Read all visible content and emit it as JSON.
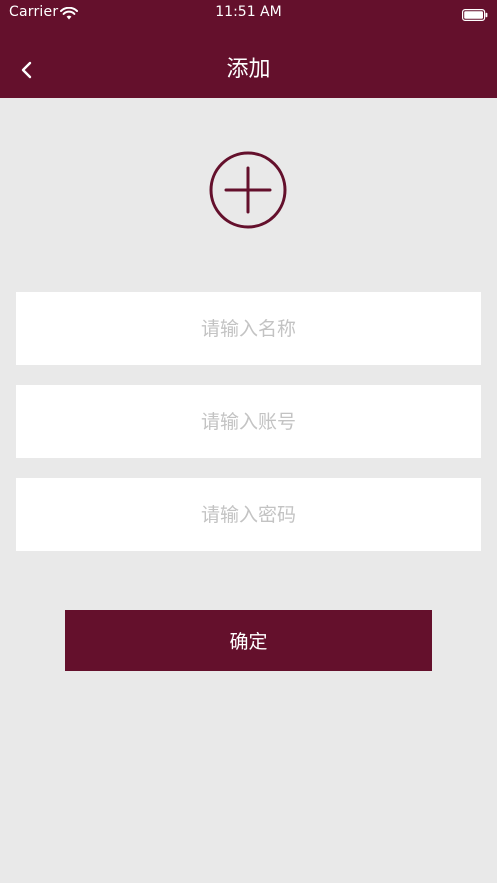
{
  "status_bar": {
    "carrier": "Carrier",
    "time": "11:51 AM"
  },
  "nav": {
    "title": "添加",
    "back_icon": "chevron-left-icon"
  },
  "avatar": {
    "icon": "plus-circle-icon"
  },
  "form": {
    "name_placeholder": "请输入名称",
    "account_placeholder": "请输入账号",
    "password_placeholder": "请输入密码",
    "name_value": "",
    "account_value": "",
    "password_value": ""
  },
  "actions": {
    "confirm_label": "确定"
  },
  "colors": {
    "brand": "#64102c",
    "background": "#e9e9e9",
    "field_background": "#ffffff",
    "placeholder": "#c3c3c3"
  }
}
